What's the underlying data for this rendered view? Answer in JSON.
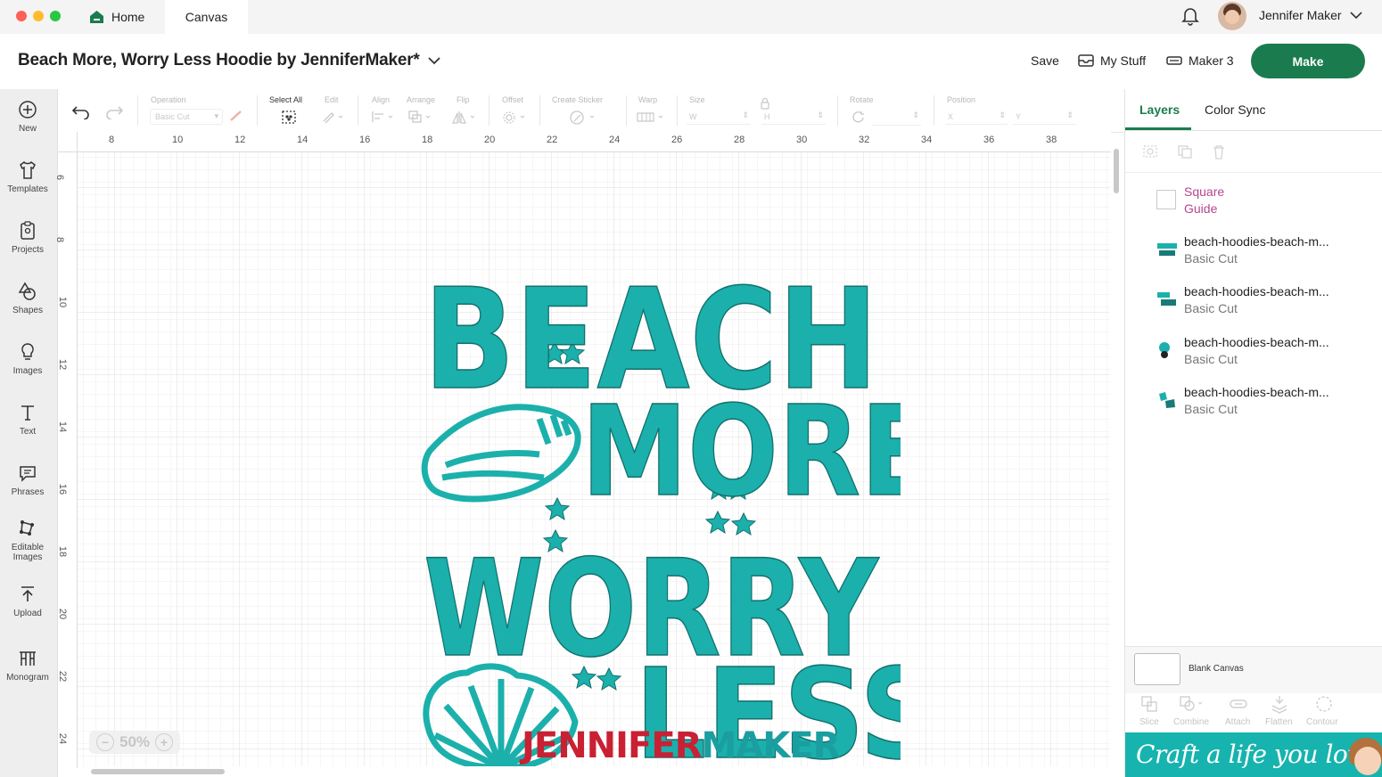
{
  "titlebar": {
    "home_label": "Home",
    "canvas_label": "Canvas",
    "user_name": "Jennifer Maker"
  },
  "header": {
    "project_title": "Beach More, Worry Less Hoodie by JenniferMaker*",
    "save_label": "Save",
    "mystuff_label": "My Stuff",
    "machine_label": "Maker 3",
    "make_label": "Make"
  },
  "sidebar": {
    "items": [
      {
        "label": "New",
        "icon": "plus-circle-icon"
      },
      {
        "label": "Templates",
        "icon": "shirt-icon"
      },
      {
        "label": "Projects",
        "icon": "clipboard-icon"
      },
      {
        "label": "Shapes",
        "icon": "shapes-icon"
      },
      {
        "label": "Images",
        "icon": "bulb-icon"
      },
      {
        "label": "Text",
        "icon": "text-icon"
      },
      {
        "label": "Phrases",
        "icon": "speech-bubble-icon"
      },
      {
        "label": "Editable",
        "label2": "Images",
        "icon": "editable-images-icon"
      },
      {
        "label": "Upload",
        "icon": "upload-icon"
      },
      {
        "label": "Monogram",
        "icon": "monogram-icon"
      }
    ]
  },
  "toolbar": {
    "operation_label": "Operation",
    "operation_value": "Basic Cut",
    "select_all_label": "Select All",
    "edit_label": "Edit",
    "align_label": "Align",
    "arrange_label": "Arrange",
    "flip_label": "Flip",
    "offset_label": "Offset",
    "create_sticker_label": "Create Sticker",
    "warp_label": "Warp",
    "size_label": "Size",
    "size_w": "W",
    "size_h": "H",
    "rotate_label": "Rotate",
    "position_label": "Position",
    "pos_x": "X",
    "pos_y": "Y"
  },
  "ruler": {
    "horizontal": [
      "8",
      "10",
      "12",
      "14",
      "16",
      "18",
      "20",
      "22",
      "24",
      "26",
      "28",
      "30",
      "32",
      "34",
      "36",
      "38"
    ],
    "vertical": [
      "6",
      "8",
      "10",
      "12",
      "14",
      "16",
      "18",
      "20",
      "22",
      "24"
    ]
  },
  "zoom": {
    "value": "50%"
  },
  "design": {
    "line1": "BEACH",
    "line2": "MORE",
    "line3": "WORRY",
    "line4": "LESS",
    "watermark_a": "JENNIFER",
    "watermark_b": "MAKER",
    "accent": "#1bb0ab",
    "watermark_red": "#c92033",
    "watermark_teal": "#1a9ea0"
  },
  "panel": {
    "tab_layers": "Layers",
    "tab_color_sync": "Color Sync",
    "layers": [
      {
        "name": "Square",
        "sub": "Guide",
        "color": "#b6468f"
      },
      {
        "name": "beach-hoodies-beach-m...",
        "sub": "Basic Cut"
      },
      {
        "name": "beach-hoodies-beach-m...",
        "sub": "Basic Cut"
      },
      {
        "name": "beach-hoodies-beach-m...",
        "sub": "Basic Cut"
      },
      {
        "name": "beach-hoodies-beach-m...",
        "sub": "Basic Cut"
      }
    ],
    "blank_canvas_label": "Blank Canvas",
    "bottom_tools": [
      "Slice",
      "Combine",
      "Attach",
      "Flatten",
      "Contour"
    ],
    "banner_text": "Craft a life you love"
  },
  "colors": {
    "make_button": "#1a7c4e",
    "active_tab": "#1a7c4e",
    "banner": "#17b3ae"
  }
}
